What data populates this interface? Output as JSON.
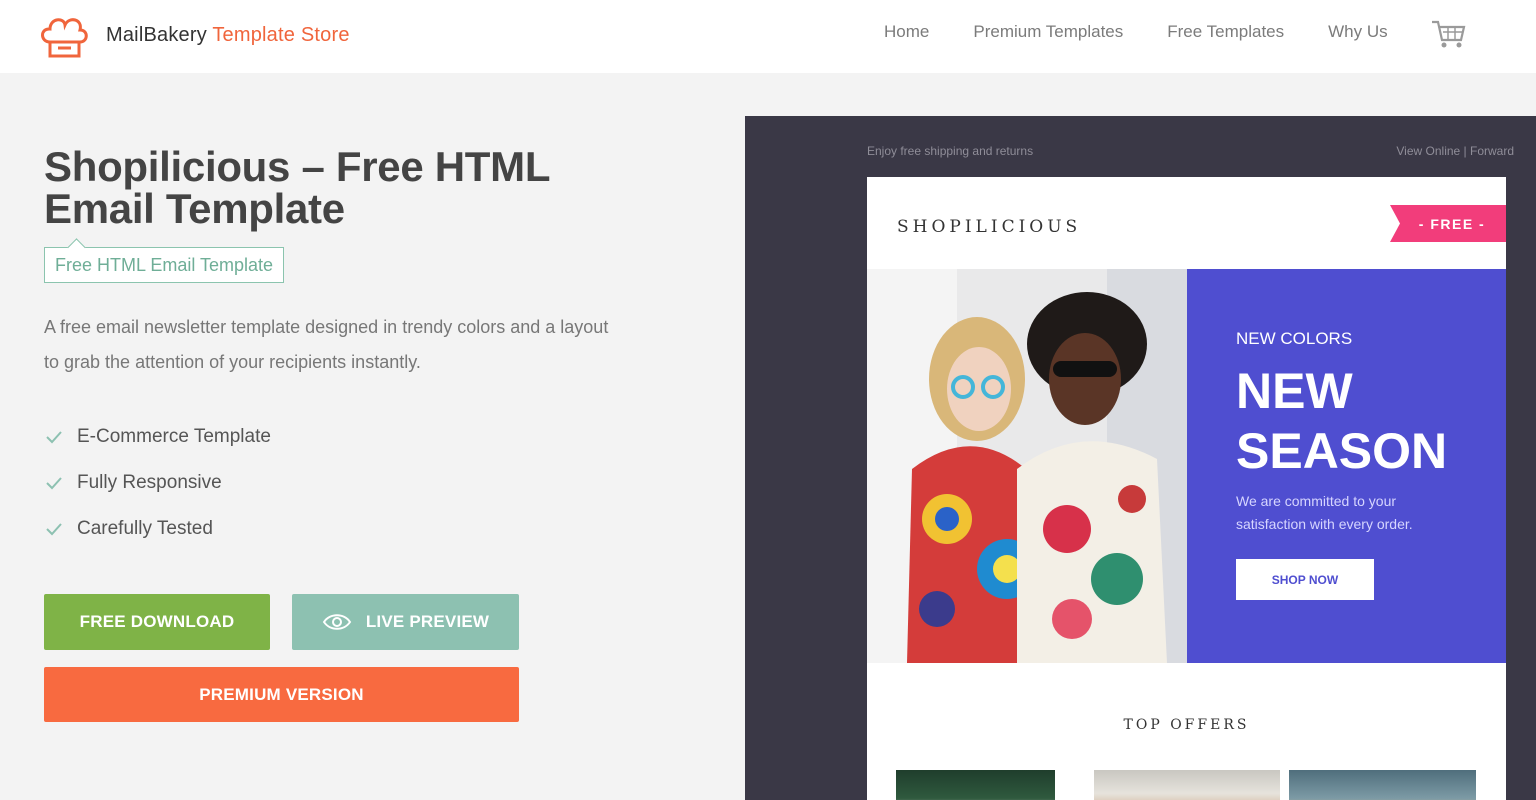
{
  "header": {
    "brand": "MailBakery",
    "store": "Template Store",
    "nav": [
      "Home",
      "Premium Templates",
      "Free Templates",
      "Why Us"
    ],
    "cart_icon": "cart-icon"
  },
  "product": {
    "title": "Shopilicious – Free HTML Email Template",
    "tag": "Free HTML Email Template",
    "description": "A free email newsletter template designed in trendy colors and a layout to grab the attention of your recipients instantly.",
    "features": [
      "E-Commerce Template",
      "Fully Responsive",
      "Carefully Tested"
    ],
    "buttons": {
      "download": "FREE DOWNLOAD",
      "preview": "LIVE PREVIEW",
      "premium": "PREMIUM VERSION"
    }
  },
  "preview": {
    "preheader_left": "Enjoy free shipping and returns",
    "preheader_right": "View Online | Forward",
    "brand": "SHOPILICIOUS",
    "ribbon": "- FREE -",
    "kicker": "NEW COLORS",
    "headline_1": "NEW",
    "headline_2": "SEASON",
    "text": "We are committed to your satisfaction with every order.",
    "cta": "SHOP NOW",
    "section_title": "TOP OFFERS"
  },
  "colors": {
    "accent_orange": "#f86a40",
    "green": "#7fb347",
    "teal": "#8dc1b1",
    "hero_blue": "#4f4ed0",
    "ribbon_pink": "#f23d7b",
    "panel_dark": "#3a3846"
  }
}
